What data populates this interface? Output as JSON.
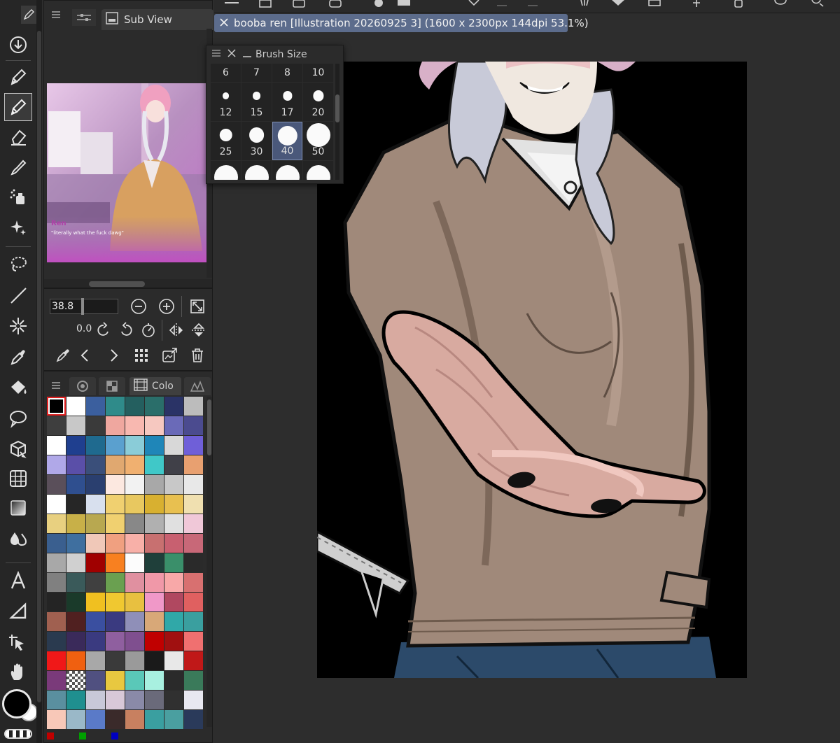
{
  "subview": {
    "title": "Sub View"
  },
  "thumbnail": {
    "speaker": "Ren",
    "dialogue": "\"literally what the fuck dawg\""
  },
  "navigator": {
    "zoom": "38.8",
    "angle": "0.0"
  },
  "document": {
    "title": "booba ren [Illustration 20260925 3] (1600 x 2300px 144dpi 53.1%)"
  },
  "brush_size": {
    "title": "Brush Size",
    "header_sizes": [
      "6",
      "7",
      "8",
      "10"
    ],
    "rows": [
      [
        "12",
        "15",
        "17",
        "20"
      ],
      [
        "25",
        "30",
        "40",
        "50"
      ],
      [
        "",
        "",
        "",
        ""
      ]
    ],
    "selected": "40"
  },
  "color_set": {
    "tab_label": "Colo",
    "selected_index": 0,
    "swatches": [
      "#000000",
      "#ffffff",
      "#3b5f9e",
      "#2f8b8a",
      "#245f5f",
      "#2a6e6a",
      "#2a3366",
      "#bcbcbc",
      "#3e3e3e",
      "#c8c8c8",
      "#3a3a3a",
      "#efa79f",
      "#f8b8b0",
      "#f6c8c0",
      "#6a6ab8",
      "#4b4b8f",
      "#ffffff",
      "#1f3f8f",
      "#1f6a8f",
      "#5aa0cf",
      "#8accd8",
      "#1f86b8",
      "#d8d8d8",
      "#6f5fd8",
      "#b0a8e8",
      "#5a4fa8",
      "#3a4f7a",
      "#e0a870",
      "#f0b070",
      "#40c8c8",
      "#404048",
      "#e8a070",
      "#5a4f5a",
      "#2f4f8f",
      "#2a3f6f",
      "#fce8e0",
      "#f2f2f2",
      "#a8a8a8",
      "#c8c8c8",
      "#e8e8e8",
      "#ffffff",
      "#262626",
      "#d8e0ee",
      "#f0d070",
      "#e8c860",
      "#d8b030",
      "#e8c050",
      "#f0e0b0",
      "#e8d080",
      "#c8b048",
      "#b8a850",
      "#f0d070",
      "#888888",
      "#b0b0b0",
      "#e0e0e0",
      "#f0c8d8",
      "#3a5f8f",
      "#3f6f9f",
      "#f0c8b8",
      "#f0a080",
      "#f8b0a8",
      "#c87070",
      "#c86070",
      "#c86878",
      "#a8a8a8",
      "#d0d0d0",
      "#a00000",
      "#f88020",
      "#fcfcfc",
      "#1f3f3a",
      "#3a8f6a",
      "#2a2a2a",
      "#808080",
      "#3a5a5a",
      "#404040",
      "#6aa050",
      "#e090a0",
      "#f098a8",
      "#f8a8a8",
      "#d87070",
      "#242424",
      "#1a3a2a",
      "#f0c020",
      "#f0c830",
      "#e8c040",
      "#f098c8",
      "#b04860",
      "#e06060",
      "#a06050",
      "#502020",
      "#3a4fa0",
      "#3a3a80",
      "#8f8fb8",
      "#d8a878",
      "#30a8a8",
      "#3a9f9f",
      "#2a3a4f",
      "#3a2a5a",
      "#3a3a80",
      "#8f5f9f",
      "#7f4f8f",
      "#c00000",
      "#a01010",
      "#f07070",
      "#f01818",
      "#f06010",
      "#a8a8a8",
      "#3a3a3a",
      "#9a9a9a",
      "#1a1a1a",
      "#e8e8e8",
      "#c01818",
      "#7a3a7a",
      "checker",
      "#505080",
      "#e8c840",
      "#5ac8b8",
      "#a8f0e0",
      "#2a2a2a",
      "#3a7a5a",
      "#5a8f9f",
      "#1f8f8f",
      "#c8c8d8",
      "#d8c8d8",
      "#8a8aa8",
      "#6a6a7a",
      "#303030",
      "#e8e8f0",
      "#f8c8b8",
      "#9ab8c8",
      "#5a7ac8",
      "#3a2a2a",
      "#c88060",
      "#3a9fa0",
      "#4a9fa0",
      "#2a3a5a"
    ],
    "bottom_markers": [
      "#c00000",
      "#00a000",
      "#0000c0"
    ]
  },
  "colors": {
    "main": "#000000",
    "sub": "#ffffff",
    "document_tab": "#5c6c8c",
    "brush_selected": "#4a587a"
  },
  "tools": [
    "tool-property-icon",
    "pen-icon",
    "pencil-icon",
    "eraser-icon",
    "brush-icon",
    "airbrush-icon",
    "decoration-icon",
    "lasso-icon",
    "line-icon",
    "fill-effect-icon",
    "eyedropper-icon",
    "fill-icon",
    "speech-balloon-icon",
    "3d-object-icon",
    "perspective-ruler-icon",
    "gradient-icon",
    "blend-icon",
    "text-icon",
    "figure-icon",
    "object-select-icon",
    "hand-icon"
  ]
}
